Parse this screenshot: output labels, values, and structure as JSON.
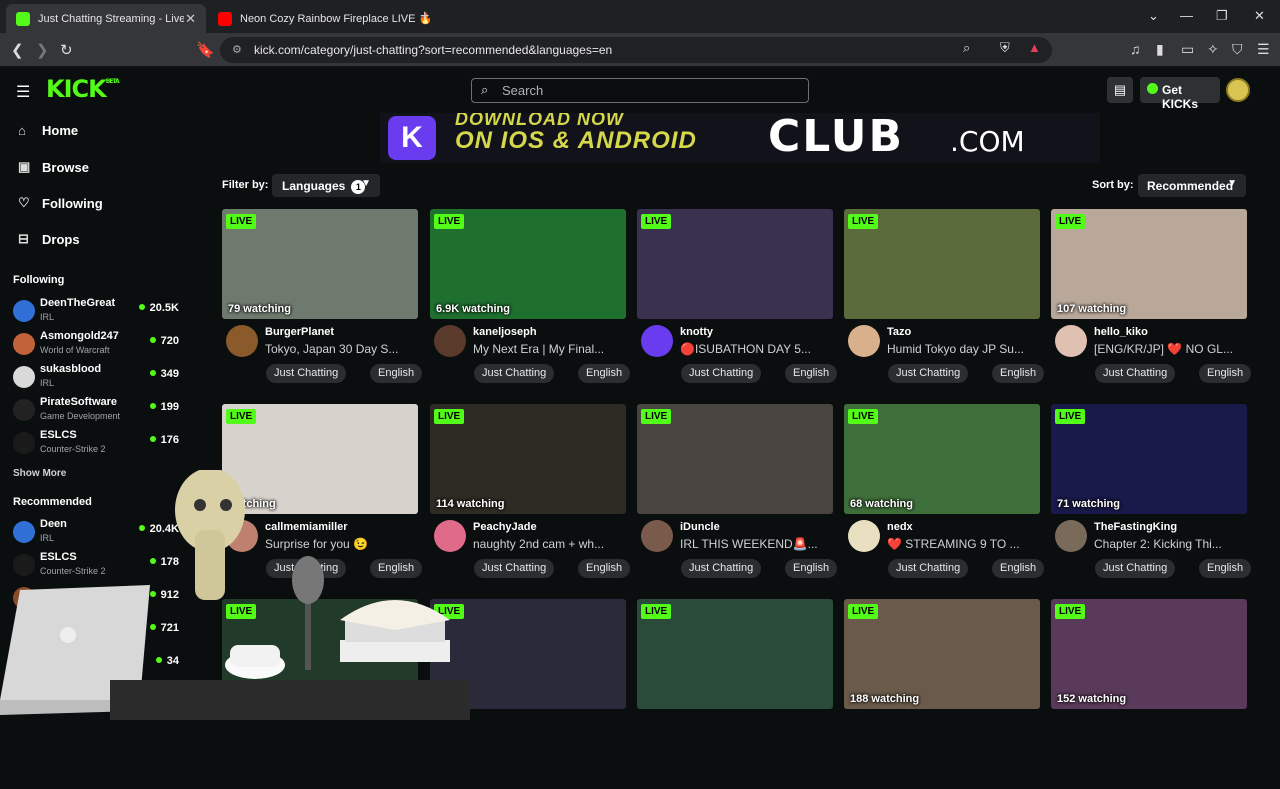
{
  "browser": {
    "tabs": [
      {
        "title": "Just Chatting Streaming - Live St",
        "active": true,
        "favicon_color": "#53fc18"
      },
      {
        "title": "Neon Cozy Rainbow Fireplace LIVE 🔥",
        "active": false,
        "favicon_color": "#ff0000"
      }
    ],
    "url": "kick.com/category/just-chatting?sort=recommended&languages=en"
  },
  "header": {
    "logo": "KICK",
    "logo_tag": "BETA",
    "search_placeholder": "Search",
    "get_kicks": "Get KICKs"
  },
  "sidebar": {
    "nav": [
      {
        "label": "Home",
        "icon": "home-icon"
      },
      {
        "label": "Browse",
        "icon": "browse-icon"
      },
      {
        "label": "Following",
        "icon": "heart-icon"
      },
      {
        "label": "Drops",
        "icon": "drops-icon"
      }
    ],
    "following_title": "Following",
    "following": [
      {
        "name": "DeenTheGreat",
        "category": "IRL",
        "viewers": "20.5K",
        "color": "#2f6fd6"
      },
      {
        "name": "Asmongold247",
        "category": "World of Warcraft",
        "viewers": "720",
        "color": "#c2623a"
      },
      {
        "name": "sukasblood",
        "category": "IRL",
        "viewers": "349",
        "color": "#d9d9d9"
      },
      {
        "name": "PirateSoftware",
        "category": "Game Development",
        "viewers": "199",
        "color": "#222"
      },
      {
        "name": "ESLCS",
        "category": "Counter-Strike 2",
        "viewers": "176",
        "color": "#1a1a1a"
      }
    ],
    "show_more": "Show More",
    "recommended_title": "Recommended",
    "recommended": [
      {
        "name": "Deen",
        "category": "IRL",
        "viewers": "20.4K",
        "color": "#2f6fd6"
      },
      {
        "name": "ESLCS",
        "category": "Counter-Strike 2",
        "viewers": "178",
        "color": "#1a1a1a"
      },
      {
        "name": "",
        "category": "",
        "viewers": "912",
        "color": "#8a4b2a"
      },
      {
        "name": "",
        "category": "",
        "viewers": "721",
        "color": "#555"
      },
      {
        "name": "",
        "category": "",
        "viewers": "34",
        "color": "#555"
      }
    ]
  },
  "banner": {
    "line1": "DOWNLOAD NOW",
    "line2": "ON IOS & ANDROID",
    "club": "CLUB",
    "com": ".COM"
  },
  "filters": {
    "filter_label": "Filter by:",
    "languages_label": "Languages",
    "languages_count": "1",
    "sort_label": "Sort by:",
    "sort_value": "Recommended"
  },
  "live_label": "LIVE",
  "streams": [
    {
      "viewers": "79 watching",
      "name": "BurgerPlanet",
      "title": "Tokyo, Japan 30 Day S...",
      "tags": [
        "Just Chatting",
        "English"
      ],
      "thumb": "#6f7a6e",
      "avatar": "#8a5a2b"
    },
    {
      "viewers": "6.9K watching",
      "name": "kaneljoseph",
      "title": "My Next Era | My Final...",
      "tags": [
        "Just Chatting",
        "English"
      ],
      "thumb": "#1f6f2f",
      "avatar": "#5a3a2a"
    },
    {
      "viewers": "",
      "name": "knotty",
      "title": "🔴ISUBATHON DAY 5...",
      "tags": [
        "Just Chatting",
        "English"
      ],
      "thumb": "#3a3050",
      "avatar": "#6a3cf0"
    },
    {
      "viewers": "",
      "name": "Tazo",
      "title": "Humid Tokyo day JP Su...",
      "tags": [
        "Just Chatting",
        "English"
      ],
      "thumb": "#5a6a3a",
      "avatar": "#d9b08c"
    },
    {
      "viewers": "107 watching",
      "name": "hello_kiko",
      "title": "[ENG/KR/JP] ❤️ NO GL...",
      "tags": [
        "Just Chatting",
        "English"
      ],
      "thumb": "#b9a89a",
      "avatar": "#e0c0b0"
    },
    {
      "viewers": "watching",
      "name": "callmemiamiller",
      "title": "Surprise for you 😉",
      "tags": [
        "Just Chatting",
        "English"
      ],
      "thumb": "#d8d2cc",
      "avatar": "#c08070"
    },
    {
      "viewers": "114 watching",
      "name": "PeachyJade",
      "title": "naughty 2nd cam + wh...",
      "tags": [
        "Just Chatting",
        "English"
      ],
      "thumb": "#2e2a24",
      "avatar": "#e06a8a"
    },
    {
      "viewers": "",
      "name": "iDuncle",
      "title": "IRL THIS WEEKEND🚨...",
      "tags": [
        "Just Chatting",
        "English"
      ],
      "thumb": "#4a4440",
      "avatar": "#7a5a4a"
    },
    {
      "viewers": "68 watching",
      "name": "nedx",
      "title": "❤️ STREAMING 9 TO ...",
      "tags": [
        "Just Chatting",
        "English"
      ],
      "thumb": "#3e6e3a",
      "avatar": "#e8e0c0"
    },
    {
      "viewers": "71 watching",
      "name": "TheFastingKing",
      "title": "Chapter 2: Kicking Thi...",
      "tags": [
        "Just Chatting",
        "English"
      ],
      "thumb": "#1a1a4a",
      "avatar": "#7a6a5a"
    },
    {
      "viewers": "",
      "name": "",
      "title": "",
      "tags": [],
      "thumb": "#223a2a",
      "avatar": ""
    },
    {
      "viewers": "",
      "name": "",
      "title": "",
      "tags": [],
      "thumb": "#2a2a3a",
      "avatar": ""
    },
    {
      "viewers": "",
      "name": "",
      "title": "",
      "tags": [],
      "thumb": "#2a4a3a",
      "avatar": ""
    },
    {
      "viewers": "188 watching",
      "name": "",
      "title": "",
      "tags": [],
      "thumb": "#6a5a4a",
      "avatar": ""
    },
    {
      "viewers": "152 watching",
      "name": "",
      "title": "",
      "tags": [],
      "thumb": "#5a3a5a",
      "avatar": ""
    }
  ]
}
